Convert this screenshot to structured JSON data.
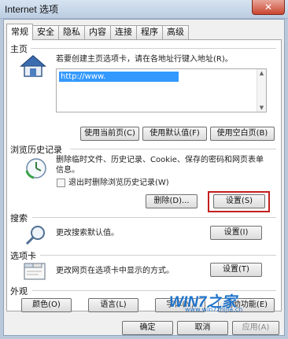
{
  "window": {
    "title": "Internet 选项",
    "close_glyph": "✕"
  },
  "tabs": [
    {
      "label": "常规"
    },
    {
      "label": "安全"
    },
    {
      "label": "隐私"
    },
    {
      "label": "内容"
    },
    {
      "label": "连接"
    },
    {
      "label": "程序"
    },
    {
      "label": "高级"
    }
  ],
  "home": {
    "section_label": "主页",
    "instruction": "若要创建主页选项卡，请在各地址行键入地址(R)。",
    "url_value": "http://www.",
    "use_current_label": "使用当前页(C)",
    "use_default_label": "使用默认值(F)",
    "use_blank_label": "使用空白页(B)"
  },
  "history": {
    "section_label": "浏览历史记录",
    "description": "删除临时文件、历史记录、Cookie、保存的密码和网页表单信息。",
    "checkbox_label": "退出时删除浏览历史记录(W)",
    "delete_label": "删除(D)...",
    "settings_label": "设置(S)"
  },
  "search": {
    "section_label": "搜索",
    "description": "更改搜索默认值。",
    "settings_label": "设置(I)"
  },
  "tabs_section": {
    "section_label": "选项卡",
    "description": "更改网页在选项卡中显示的方式。",
    "settings_label": "设置(T)"
  },
  "appearance": {
    "section_label": "外观",
    "colors_label": "颜色(O)",
    "languages_label": "语言(L)",
    "fonts_label": "字体(N)",
    "accessibility_label": "辅助功能(E)"
  },
  "footer": {
    "ok_label": "确定",
    "cancel_label": "取消",
    "apply_label": "应用(A)"
  },
  "watermark": {
    "brand": "WIN7之家",
    "url": "www.win7zhijia.cn"
  },
  "colors": {
    "highlight": "#c21f1f",
    "selection": "#3399ff"
  }
}
